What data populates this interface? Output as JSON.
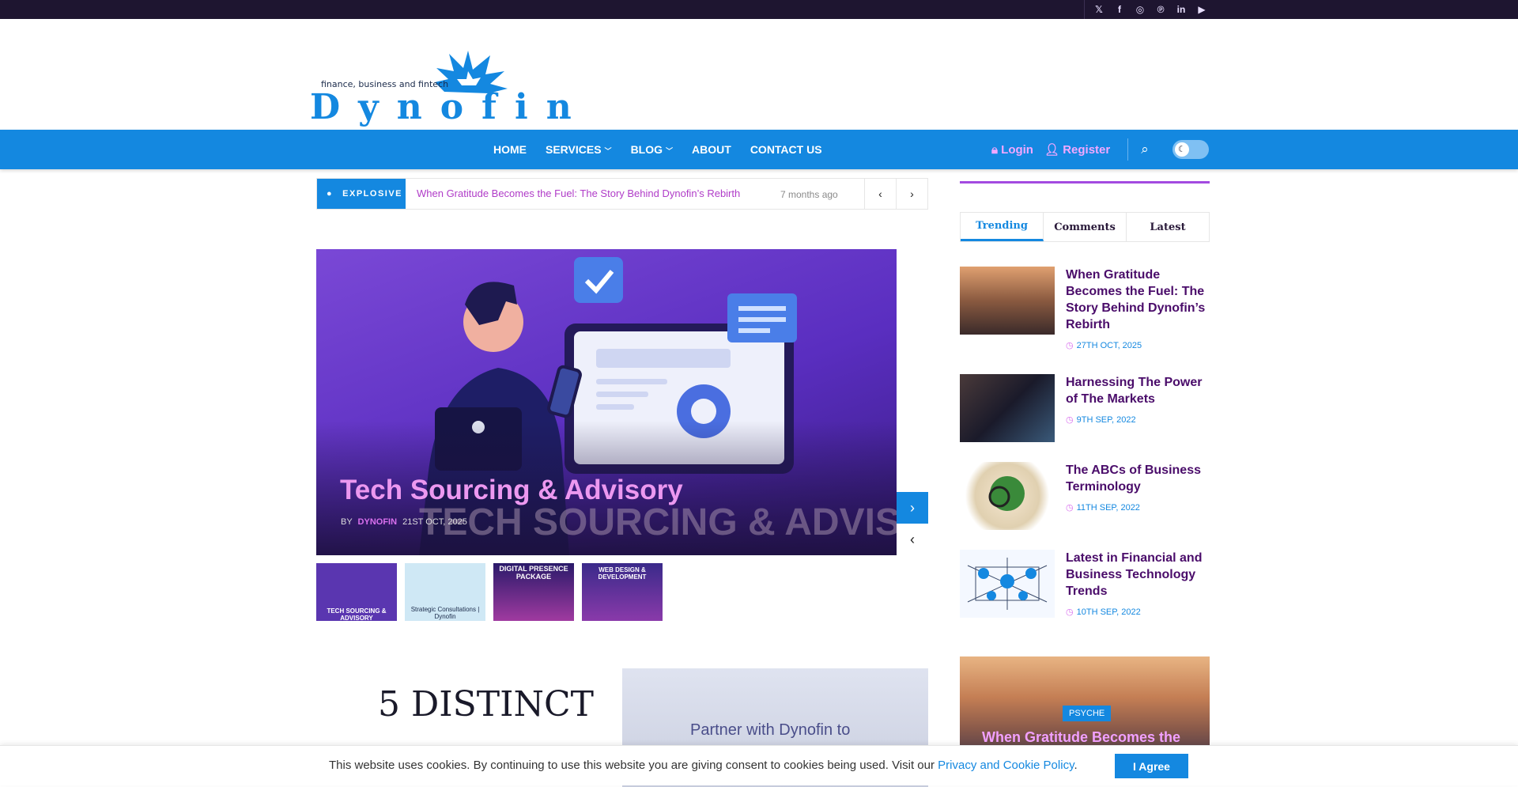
{
  "topbar": {
    "social": [
      {
        "icon": "x-icon",
        "glyph": "𝕏"
      },
      {
        "icon": "facebook-icon",
        "glyph": "f"
      },
      {
        "icon": "instagram-icon",
        "glyph": "◎"
      },
      {
        "icon": "pinterest-icon",
        "glyph": "℗"
      },
      {
        "icon": "linkedin-icon",
        "glyph": "in"
      },
      {
        "icon": "youtube-icon",
        "glyph": "▶"
      }
    ]
  },
  "logo": {
    "tagline": "finance, business and fintech",
    "wordmark": "Dynofin"
  },
  "nav": {
    "home": "HOME",
    "services": "SERVICES",
    "blog": "BLOG",
    "about": "ABOUT",
    "contact": "CONTACT US",
    "login": "Login",
    "register": "Register"
  },
  "ticker": {
    "label": "EXPLOSIVE",
    "headline": "When Gratitude Becomes the Fuel: The Story Behind Dynofin’s Rebirth",
    "time": "7 months ago"
  },
  "hero": {
    "title": "Tech Sourcing & Advisory",
    "bg_text": "TECH SOURCING & ADVISORY",
    "by": "BY",
    "author": "DYNOFIN",
    "date": "21ST OCT, 2025"
  },
  "thumbs": [
    {
      "caption": "TECH SOURCING & ADVISORY",
      "bg": "#5a36b0"
    },
    {
      "caption": "Strategic Consultations | Dynofin",
      "bg": "#cfe8f5"
    },
    {
      "caption": "DIGITAL PRESENCE PACKAGE",
      "bg": "#7a2a9a"
    },
    {
      "caption": "WEB DESIGN & DEVELOPMENT",
      "bg": "#4a2a8a"
    }
  ],
  "content": {
    "heading": "5 DISTINCT",
    "partner": "Partner with Dynofin to"
  },
  "sidebar": {
    "tabs": [
      "Trending",
      "Comments",
      "Latest"
    ],
    "posts": [
      {
        "title": "When Gratitude Becomes the Fuel: The Story Behind Dynofin’s Rebirth",
        "date": "27TH OCT, 2025"
      },
      {
        "title": "Harnessing The Power of The Markets",
        "date": "9TH SEP, 2022"
      },
      {
        "title": "The ABCs of Business Terminology",
        "date": "11TH SEP, 2022"
      },
      {
        "title": "Latest in Financial and Business Technology Trends",
        "date": "10TH SEP, 2022"
      }
    ],
    "feature": {
      "badge": "PSYCHE",
      "title": "When Gratitude Becomes the"
    }
  },
  "cookie": {
    "text": "This website uses cookies. By continuing to use this website you are giving consent to cookies being used. Visit our ",
    "link": "Privacy and Cookie Policy",
    "after": ".",
    "button": "I Agree"
  },
  "colors": {
    "brand_blue": "#1488e0",
    "accent_purple": "#4a0c6a",
    "accent_pink": "#d970ee"
  }
}
